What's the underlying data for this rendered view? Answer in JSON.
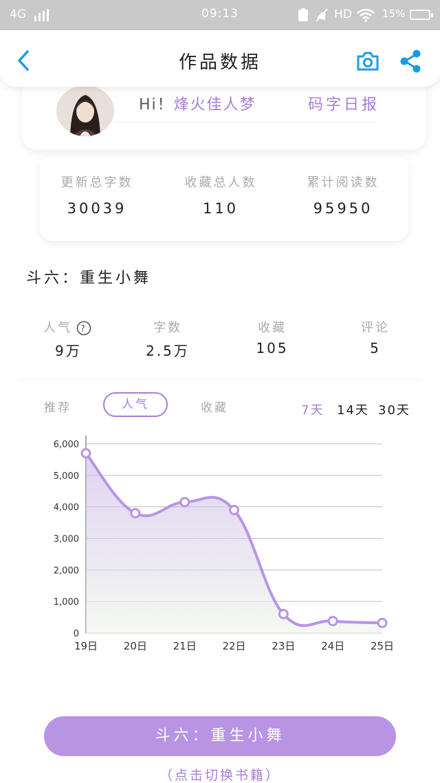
{
  "status_bar": {
    "network": "4G",
    "time": "09:13",
    "hd": "HD",
    "battery": "15%"
  },
  "header": {
    "title": "作品数据",
    "icons": [
      "back-arrow-icon",
      "camera-icon",
      "share-icon"
    ]
  },
  "profile": {
    "greeting": "Hi！",
    "username": "烽火佳人梦",
    "report_link": "码字日报"
  },
  "totals": [
    {
      "label": "更新总字数",
      "value": "30039"
    },
    {
      "label": "收藏总人数",
      "value": "110"
    },
    {
      "label": "累计阅读数",
      "value": "95950"
    }
  ],
  "book": {
    "title": "斗六：重生小舞",
    "stats": [
      {
        "label": "人气",
        "value": "9万",
        "has_help": true
      },
      {
        "label": "字数",
        "value": "2.5万"
      },
      {
        "label": "收藏",
        "value": "105"
      },
      {
        "label": "评论",
        "value": "5"
      }
    ]
  },
  "tabs": {
    "items": [
      "推荐",
      "人气",
      "收藏"
    ],
    "active": "人气"
  },
  "ranges": {
    "items": [
      "7天",
      "14天",
      "30天"
    ],
    "active": "7天"
  },
  "chart_data": {
    "type": "area",
    "categories": [
      "19日",
      "20日",
      "21日",
      "22日",
      "23日",
      "24日",
      "25日"
    ],
    "values": [
      5700,
      3800,
      4150,
      3900,
      600,
      380,
      320
    ],
    "ylim": [
      0,
      6000
    ],
    "yticks": [
      "0",
      "1,000",
      "2,000",
      "3,000",
      "4,000",
      "5,000",
      "6,000"
    ],
    "grid": true,
    "color": "#b894e3"
  },
  "footer": {
    "button_label": "斗六：重生小舞",
    "hint": "（点击切换书籍）"
  },
  "colors": {
    "accent": "#a67ed6",
    "button": "#b894e3",
    "link_blue": "#1a9be6"
  }
}
